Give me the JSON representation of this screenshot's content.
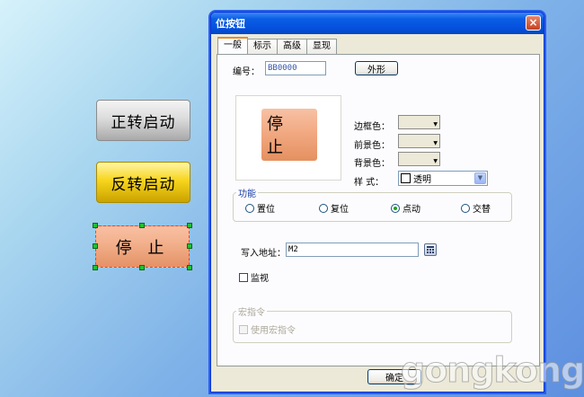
{
  "canvas": {
    "buttons": [
      {
        "label": "正转启动"
      },
      {
        "label": "反转启动"
      },
      {
        "label": "停 止"
      }
    ]
  },
  "dialog": {
    "title": "位按钮",
    "close": "×",
    "tabs": [
      "一般",
      "标示",
      "高级",
      "显现"
    ],
    "general": {
      "id_label": "编号：",
      "id_value": "BB0000",
      "shape_button": "外形",
      "preview_text": "停 止",
      "border_color_label": "边框色：",
      "fore_color_label": "前景色：",
      "back_color_label": "背景色：",
      "style_label": "样  式：",
      "style_value": "透明",
      "function_group": "功能",
      "radios": [
        {
          "label": "置位",
          "checked": false
        },
        {
          "label": "复位",
          "checked": false
        },
        {
          "label": "点动",
          "checked": true
        },
        {
          "label": "交替",
          "checked": false
        }
      ],
      "write_addr_label": "写入地址：",
      "write_addr_value": "M2",
      "monitor_label": "监视",
      "macro_group": "宏指令",
      "use_macro_label": "使用宏指令",
      "ok_label": "确定"
    }
  },
  "watermark": "gongkong",
  "colors": {
    "accent": "#0a5ee4",
    "stop_button": "#f3b18d",
    "reverse_button": "#f7d51c",
    "forward_button": "#d6d6d6"
  }
}
